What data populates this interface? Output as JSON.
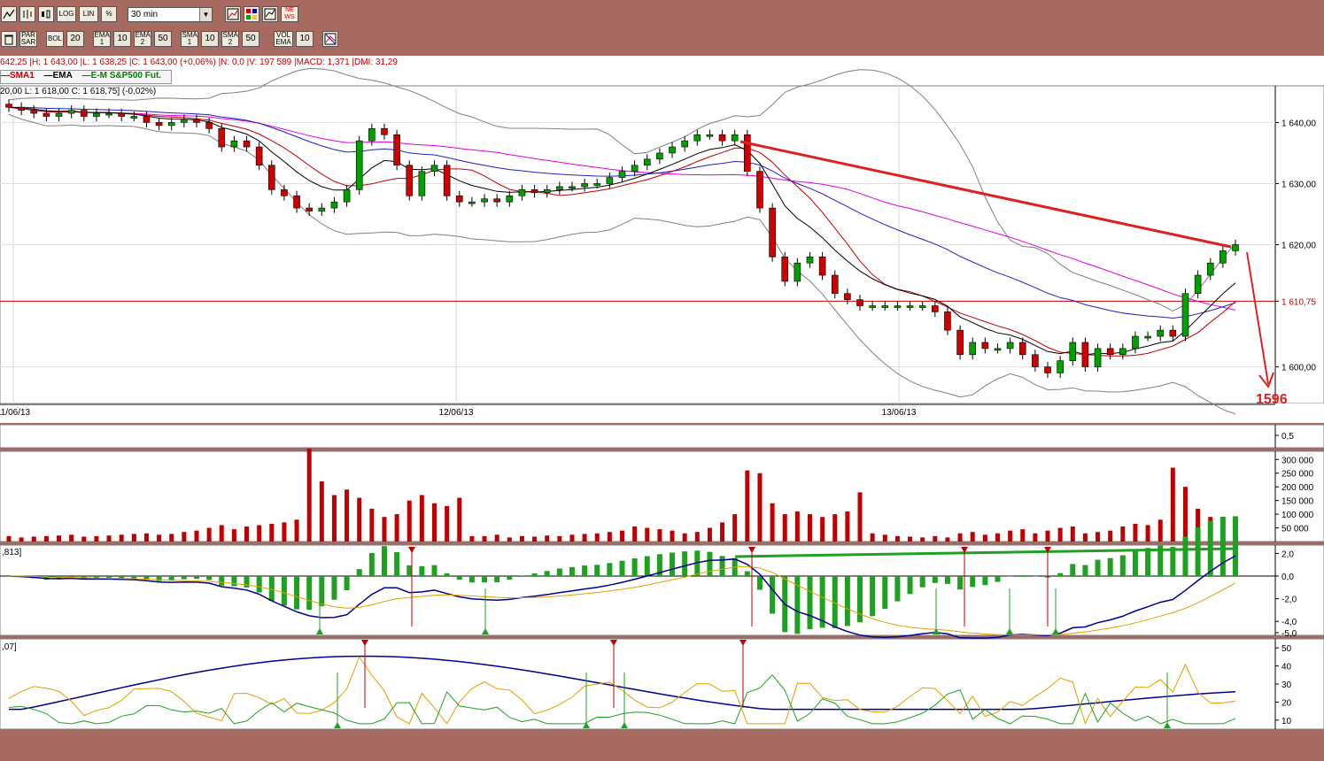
{
  "toolbar1": {
    "buttons": [
      {
        "name": "line-chart-icon"
      },
      {
        "name": "bar-chart-icon"
      },
      {
        "name": "candle-chart-icon"
      },
      {
        "label": "LOG"
      },
      {
        "label": "LIN"
      },
      {
        "label": "%"
      }
    ],
    "timeframe": "30 min",
    "right_buttons": [
      {
        "name": "chart-settings-icon"
      },
      {
        "name": "palette-icon"
      },
      {
        "name": "compare-chart-icon"
      },
      {
        "label": "NE WS"
      }
    ]
  },
  "toolbar2": {
    "items": [
      {
        "label": "",
        "name": "trash-icon"
      },
      {
        "label": "PAR SAR"
      },
      {
        "label": "BOL"
      },
      {
        "label": "20",
        "num": true
      },
      {
        "label": "EMA 1"
      },
      {
        "label": "10",
        "num": true
      },
      {
        "label": "EMA 2"
      },
      {
        "label": "50",
        "num": true
      },
      {
        "label": "SMA 1"
      },
      {
        "label": "10",
        "num": true
      },
      {
        "label": "SMA 2"
      },
      {
        "label": "50",
        "num": true
      },
      {
        "label": "VOL EMA"
      },
      {
        "label": "10",
        "num": true
      },
      {
        "label": "",
        "name": "indicator-icon"
      }
    ]
  },
  "info": {
    "quote_line": "642,25 |H: 1 643,00 |L: 1 638,25 |C: 1 643,00 (+0,06%) |N: 0,0 |V: 197 589 |MACD: 1,371 |DMI: 31,29",
    "legend": [
      {
        "label": "SMA1",
        "color": "#c00000"
      },
      {
        "label": "EMA",
        "color": "#000000"
      },
      {
        "label": "E-M S&P500 Fut.",
        "color": "#008000"
      }
    ],
    "price_head": "20,00  L: 1 618,00  C: 1 618,75] (-0,02%)"
  },
  "chart_data": [
    {
      "type": "candlestick",
      "ylim": [
        1594,
        1646
      ],
      "yticks": [
        "1 640,00",
        "1 630,00",
        "1 620,00",
        "1 610,75",
        "1 600,00"
      ],
      "ytick_values": [
        1640,
        1630,
        1620,
        1610.75,
        1600
      ],
      "date_labels": [
        "11/06/13",
        "12/06/13",
        "13/06/13"
      ],
      "annotation": "1596",
      "colors": {
        "up": "#00a000",
        "down": "#d00000",
        "sma": "#c00000",
        "ema": "#000000",
        "ema50": "#2020c0",
        "sma50": "#e000e0",
        "bollinger": "#808080",
        "trend": "#e02020"
      },
      "close": [
        1642.5,
        1642,
        1641.5,
        1641,
        1641.5,
        1642,
        1641,
        1641.5,
        1641.5,
        1641,
        1641,
        1640,
        1639.5,
        1640,
        1640.5,
        1640,
        1639,
        1636,
        1637,
        1636,
        1633,
        1629,
        1628,
        1626,
        1625.5,
        1626,
        1627,
        1629,
        1637,
        1639,
        1638,
        1633,
        1628,
        1632,
        1633,
        1628,
        1627,
        1627,
        1627.5,
        1627,
        1628,
        1629,
        1628.5,
        1629,
        1629.5,
        1629.5,
        1630,
        1630,
        1631,
        1632,
        1633,
        1634,
        1635,
        1636,
        1637,
        1638,
        1638,
        1637,
        1638,
        1632,
        1626,
        1618,
        1614,
        1617,
        1618,
        1615,
        1612,
        1611,
        1610,
        1610,
        1610,
        1610,
        1610,
        1610,
        1609,
        1606,
        1602,
        1604,
        1603,
        1603,
        1604,
        1602,
        1600,
        1599,
        1601,
        1604,
        1600,
        1603,
        1602,
        1603,
        1605,
        1605,
        1606,
        1605,
        1612,
        1615,
        1617,
        1619,
        1620
      ],
      "volume": [
        20,
        15,
        18,
        20,
        22,
        25,
        18,
        20,
        22,
        25,
        28,
        30,
        25,
        28,
        35,
        40,
        50,
        60,
        45,
        55,
        60,
        65,
        70,
        80,
        340,
        220,
        170,
        190,
        160,
        120,
        90,
        100,
        150,
        170,
        140,
        130,
        160,
        20,
        20,
        25,
        15,
        20,
        18,
        22,
        20,
        25,
        28,
        30,
        35,
        40,
        55,
        50,
        45,
        40,
        30,
        35,
        50,
        70,
        100,
        260,
        250,
        140,
        100,
        110,
        100,
        90,
        100,
        110,
        180,
        30,
        25,
        20,
        18,
        15,
        20,
        15,
        30,
        35,
        25,
        30,
        40,
        45,
        30,
        40,
        50,
        55,
        30,
        35,
        40,
        55,
        65,
        60,
        80,
        270,
        200,
        120,
        90,
        80,
        60
      ],
      "macd_ylim": [
        -5,
        2.5
      ],
      "macd_ticks": [
        "2,0",
        "0,0",
        "-2,0",
        "-4,0",
        "-5,0"
      ],
      "macd_tick_values": [
        2,
        0,
        -2,
        -4,
        -5
      ],
      "dmi_ylim": [
        5,
        55
      ],
      "dmi_ticks": [
        "50",
        "40",
        "30",
        "20",
        "10"
      ],
      "dmi_tick_values": [
        50,
        40,
        30,
        20,
        10
      ],
      "osc_ticks": [
        "0,5"
      ],
      "vol_ticks": [
        "300 000",
        "250 000",
        "200 000",
        "150 000",
        "100 000",
        "50 000"
      ],
      "vol_tick_values": [
        300000,
        250000,
        200000,
        150000,
        100000,
        50000
      ],
      "macd_label": ",813]",
      "dmi_label": ",07]"
    }
  ]
}
